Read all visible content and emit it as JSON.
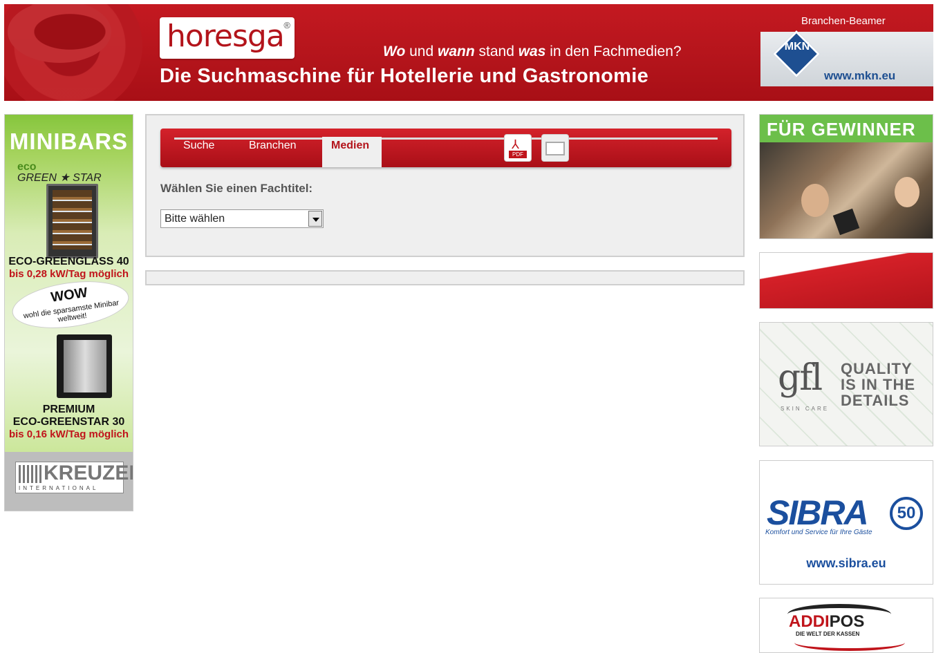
{
  "header": {
    "logo_text": "horesga",
    "logo_reg": "®",
    "tagline": {
      "w1": "Wo",
      "t1": " und ",
      "w2": "wann",
      "t2": " stand ",
      "w3": "was",
      "t3": " in den Fachmedien?"
    },
    "subtitle": "Die Suchmaschine für Hotellerie und Gastronomie",
    "beamer_label": "Branchen-Beamer",
    "beamer_ad": {
      "logo": "MKN",
      "url": "www.mkn.eu"
    }
  },
  "left_ad": {
    "title": "MINIBARS",
    "brand_eco": "eco",
    "brand": "GREEN ★ STAR",
    "product1": "ECO-GREENGLASS 40",
    "product1_note": "bis 0,28 kW/Tag möglich",
    "wow": "WOW",
    "wow_sub": "wohl die sparsamste Minibar weltweit!",
    "product2_line1": "PREMIUM",
    "product2_line2": "ECO-GREENSTAR 30",
    "product2_note": "bis 0,16 kW/Tag möglich",
    "company": "KREUZER",
    "company_sub": "INTERNATIONAL"
  },
  "nav": {
    "tabs": [
      {
        "label": "Suche"
      },
      {
        "label": "Branchen"
      },
      {
        "label": "Medien",
        "active": true
      }
    ],
    "pdf_icon_label": "PDF"
  },
  "main": {
    "fachtitel_label": "Wählen Sie einen Fachtitel:",
    "select_value": "Bitte wählen"
  },
  "right_ads": {
    "gewinner": "FÜR GEWINNER",
    "gfl_logo": "gfl",
    "gfl_skin": "SKIN CARE",
    "gfl_quality": "QUALITY IS IN THE DETAILS",
    "sibra_logo": "SIBRA",
    "sibra_50": "50",
    "sibra_slogan": "Komfort und Service für Ihre Gäste",
    "sibra_url": "www.sibra.eu",
    "addipos_logo_red": "ADDI",
    "addipos_logo_black": "POS",
    "addipos_sub": "DIE WELT DER KASSEN"
  },
  "colors": {
    "brand_red": "#b3141b",
    "panel_bg": "#efefef",
    "sibra_blue": "#1b4f9e"
  }
}
